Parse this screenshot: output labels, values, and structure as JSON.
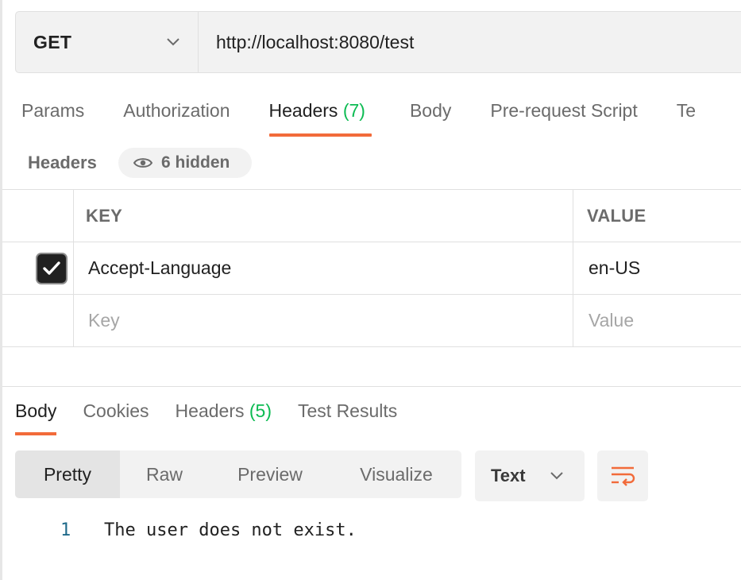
{
  "request": {
    "method": "GET",
    "url": "http://localhost:8080/test"
  },
  "request_tabs": [
    {
      "label": "Params",
      "count": ""
    },
    {
      "label": "Authorization",
      "count": ""
    },
    {
      "label": "Headers ",
      "count": "(7)"
    },
    {
      "label": "Body",
      "count": ""
    },
    {
      "label": "Pre-request Script",
      "count": ""
    },
    {
      "label": "Te",
      "count": ""
    }
  ],
  "headers_section": {
    "title": "Headers",
    "hidden_label": "6 hidden"
  },
  "headers_table": {
    "columns": [
      "KEY",
      "VALUE"
    ],
    "rows": [
      {
        "key": "Accept-Language",
        "value": "en-US",
        "checked": true
      }
    ],
    "placeholder_key": "Key",
    "placeholder_value": "Value"
  },
  "response_tabs": [
    {
      "label": "Body",
      "count": ""
    },
    {
      "label": "Cookies",
      "count": ""
    },
    {
      "label": "Headers ",
      "count": "(5)"
    },
    {
      "label": "Test Results",
      "count": ""
    }
  ],
  "view_modes": [
    "Pretty",
    "Raw",
    "Preview",
    "Visualize"
  ],
  "format": "Text",
  "response_body": {
    "line_number": "1",
    "text": "The user does not exist."
  },
  "colors": {
    "accent": "#f26b3a",
    "count_green": "#0cbb52",
    "line_number": "#1f6a8a"
  }
}
